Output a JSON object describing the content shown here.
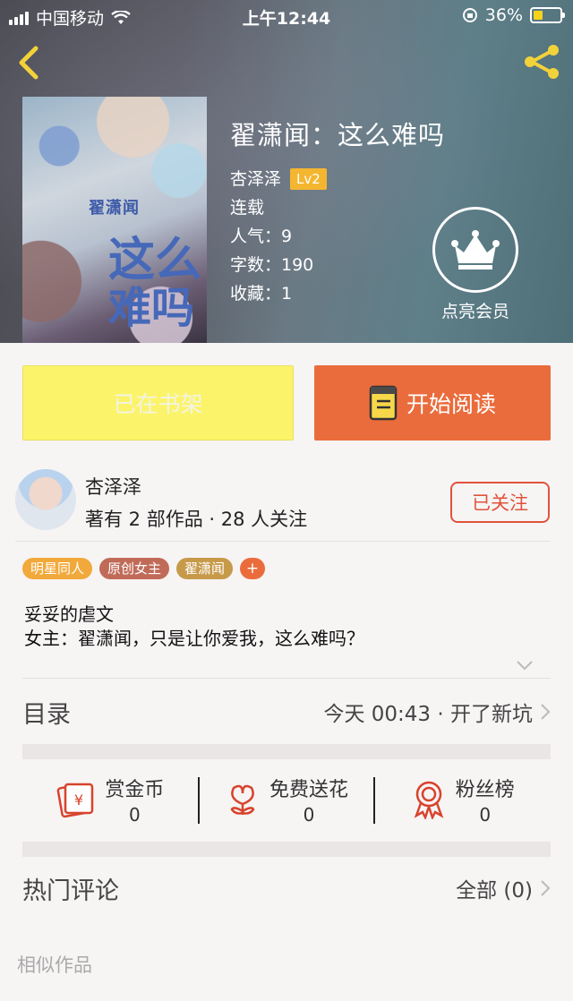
{
  "status_bar": {
    "carrier": "中国移动",
    "time": "上午12:44",
    "battery_pct": "36%"
  },
  "book": {
    "title": "翟潇闻：这么难吗",
    "author": "杏泽泽",
    "level": "Lv2",
    "status": "连载",
    "popularity": "人气：9",
    "word_count": "字数：190",
    "favorites": "收藏：1",
    "cover_text_small": "翟潇闻",
    "cover_text_line1": "这么",
    "cover_text_line2": "难吗"
  },
  "vip": {
    "label": "点亮会员"
  },
  "actions": {
    "shelf_label": "已在书架",
    "read_label": "开始阅读"
  },
  "author": {
    "name": "杏泽泽",
    "stats": "著有 2 部作品 · 28 人关注",
    "follow_label": "已关注"
  },
  "tags": [
    {
      "label": "明星同人",
      "color": "#f2a93b"
    },
    {
      "label": "原创女主",
      "color": "#c06b58"
    },
    {
      "label": "翟潇闻",
      "color": "#c79a4a"
    },
    {
      "label": "+",
      "color": "#ea6c3c"
    }
  ],
  "description": {
    "line1": "妥妥的虐文",
    "line2": "女主：翟潇闻，只是让你爱我，这么难吗？"
  },
  "catalog": {
    "label": "目录",
    "update": "今天 00:43 · 开了新坑"
  },
  "rewards": [
    {
      "label": "赏金币",
      "value": "0",
      "icon": "red-envelope-icon"
    },
    {
      "label": "免费送花",
      "value": "0",
      "icon": "flower-icon"
    },
    {
      "label": "粉丝榜",
      "value": "0",
      "icon": "medal-icon"
    }
  ],
  "comments": {
    "label": "热门评论",
    "all": "全部 (0)"
  },
  "similar": {
    "label": "相似作品"
  },
  "colors": {
    "accent": "#ea6c3c",
    "shelf": "#fbf46a",
    "follow": "#e0533c"
  }
}
